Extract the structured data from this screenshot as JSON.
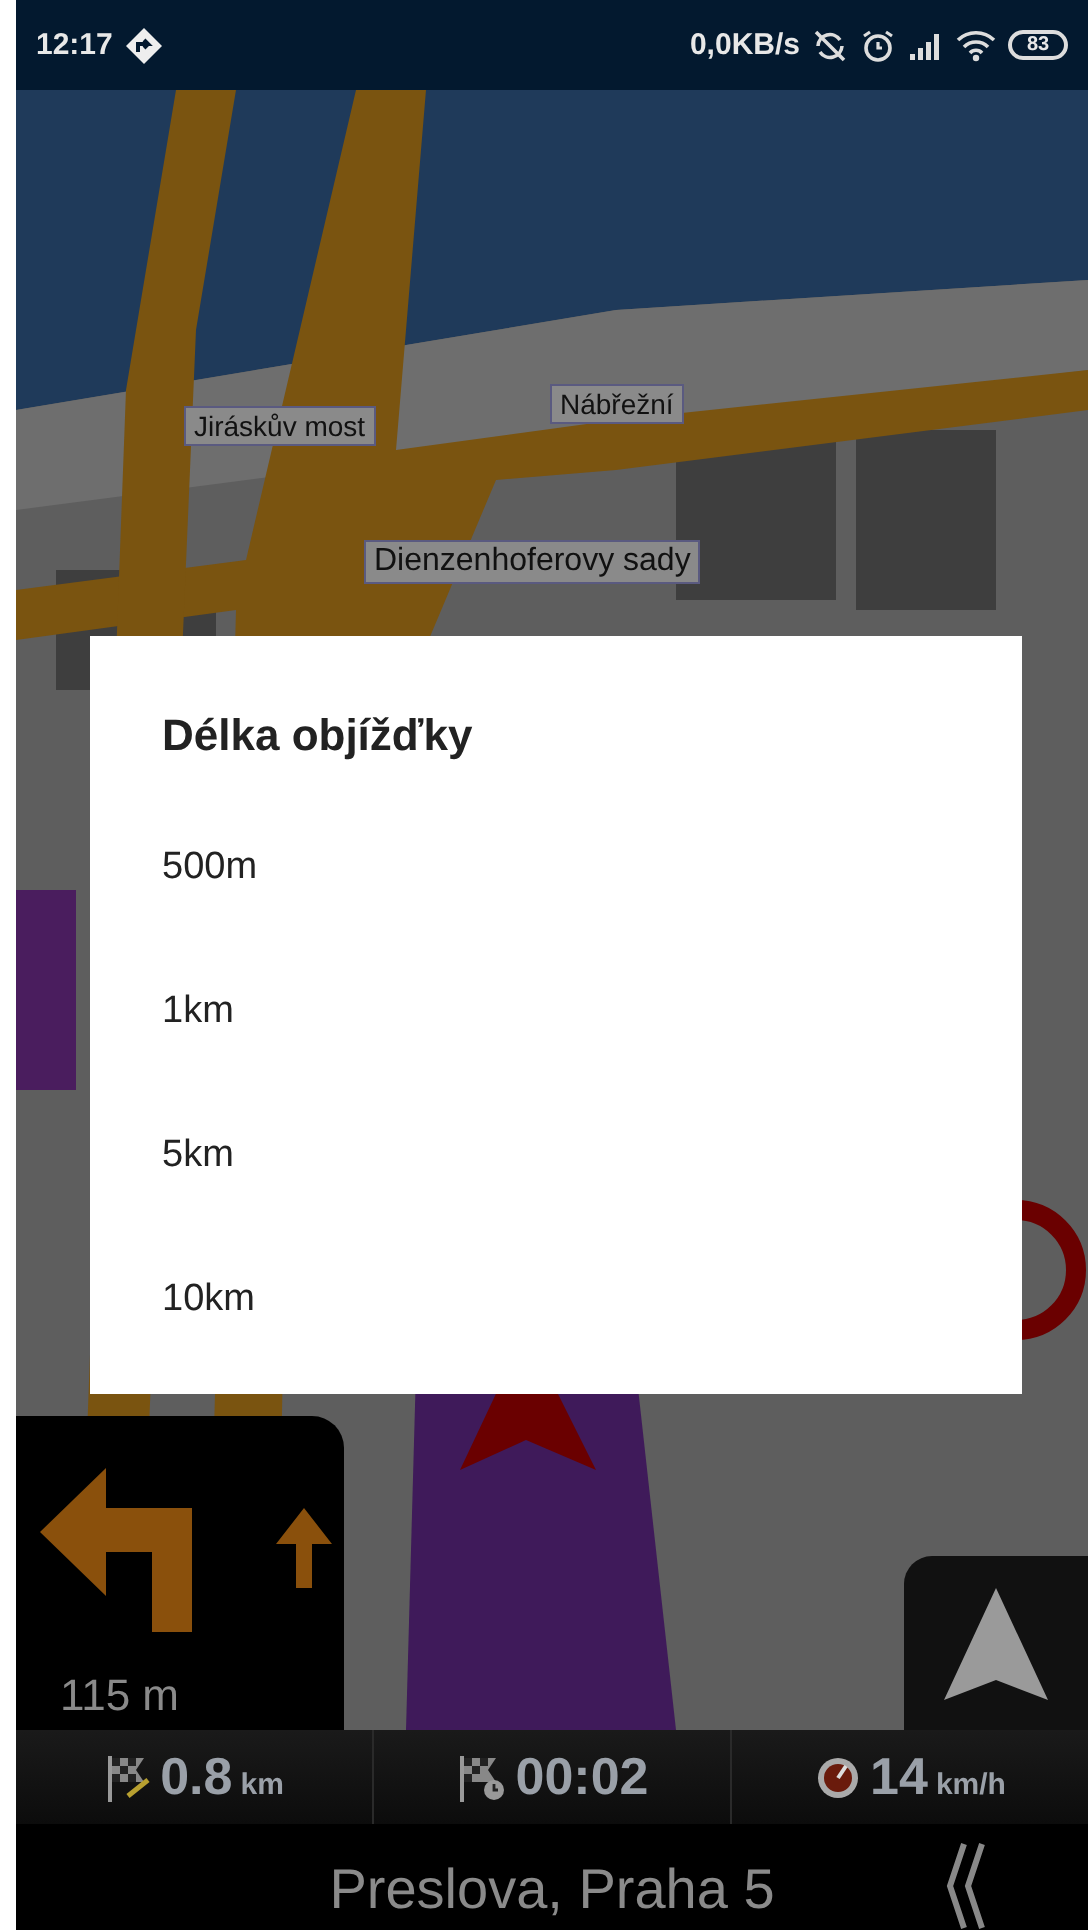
{
  "status_bar": {
    "time": "12:17",
    "network_speed": "0,0KB/s",
    "battery": "83"
  },
  "map": {
    "labels": [
      {
        "text": "Jiráskův most"
      },
      {
        "text": "Nábřežní"
      },
      {
        "text": "Dienzenhoferovy sady"
      }
    ]
  },
  "maneuver": {
    "distance": "115 m"
  },
  "dialog": {
    "title": "Délka objížďky",
    "options": [
      "500m",
      "1km",
      "5km",
      "10km"
    ]
  },
  "trip_info": [
    {
      "kind": "distance",
      "value": "0.8",
      "unit": "km"
    },
    {
      "kind": "time",
      "value": "00:02"
    },
    {
      "kind": "speed",
      "value": "14",
      "unit": "km/h"
    }
  ],
  "street": {
    "name": "Preslova, Praha 5"
  }
}
